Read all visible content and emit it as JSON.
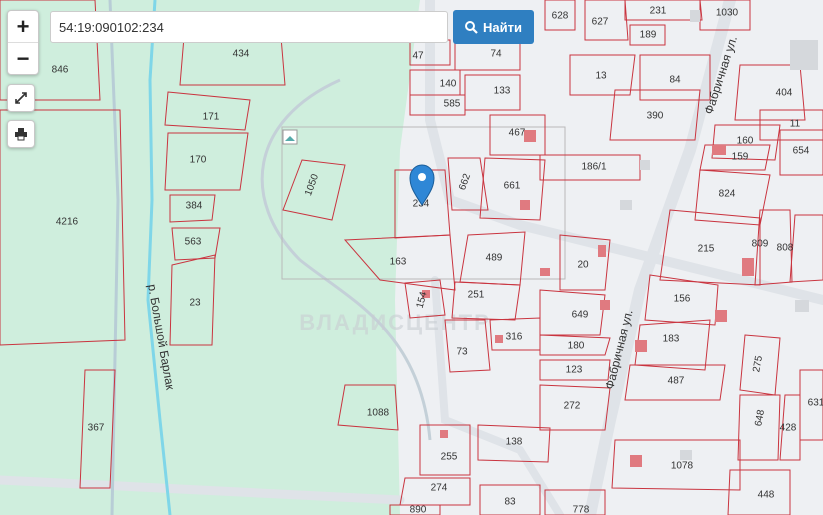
{
  "search": {
    "value": "54:19:090102:234",
    "button_label": "Найти"
  },
  "controls": {
    "zoom_in": "+",
    "zoom_out": "−"
  },
  "map": {
    "watermark": "ВЛАДИСЦЕНТР",
    "streets": {
      "river": "р. Большой Барлак",
      "fabrichnaya_top": "Фабричная ул.",
      "fabrichnaya_bottom": "Фабричная ул."
    },
    "plots": [
      "846",
      "434",
      "171",
      "170",
      "384",
      "563",
      "23",
      "4216",
      "367",
      "1050",
      "1088",
      "234",
      "163",
      "154",
      "73",
      "255",
      "274",
      "890",
      "628",
      "627",
      "231",
      "1030",
      "189",
      "47",
      "74",
      "140",
      "585",
      "133",
      "13",
      "84",
      "404",
      "390",
      "467",
      "11",
      "160",
      "159",
      "654",
      "186/1",
      "662",
      "661",
      "824",
      "215",
      "809",
      "808",
      "489",
      "20",
      "251",
      "156",
      "649",
      "316",
      "183",
      "180",
      "275",
      "123",
      "487",
      "272",
      "631",
      "648",
      "428",
      "138",
      "1078",
      "448",
      "83",
      "778"
    ]
  },
  "marker": {
    "plot": "234"
  }
}
